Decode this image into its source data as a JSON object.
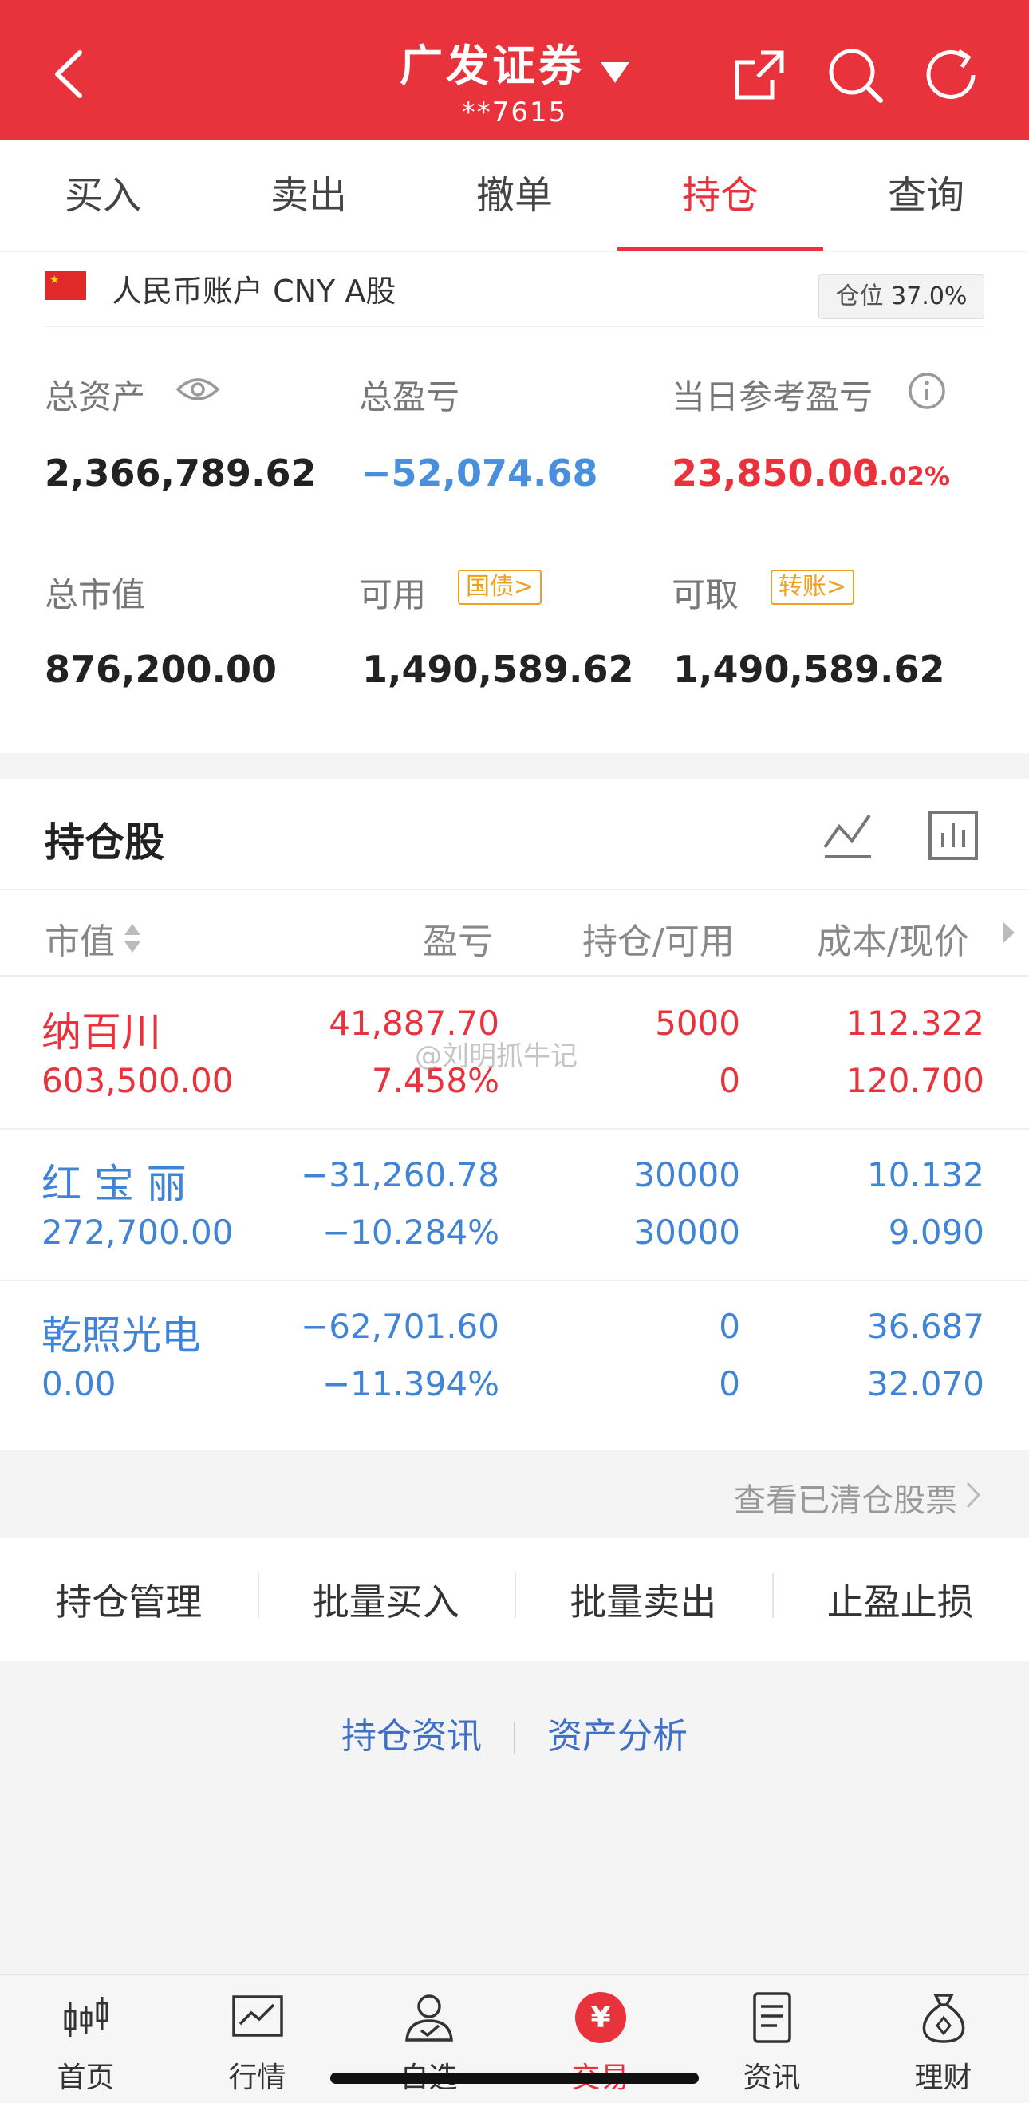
{
  "header": {
    "title": "广发证券",
    "account": "**7615",
    "colors": {
      "brand": "#e8333c"
    }
  },
  "tabs": [
    {
      "label": "买入"
    },
    {
      "label": "卖出"
    },
    {
      "label": "撤单"
    },
    {
      "label": "持仓",
      "active": true
    },
    {
      "label": "查询"
    }
  ],
  "account_info": {
    "currency_line": "人民币账户 CNY A股",
    "position_label": "仓位",
    "position_value": "37.0%"
  },
  "summary": {
    "total_assets_label": "总资产",
    "total_assets": "2,366,789.62",
    "total_pnl_label": "总盈亏",
    "total_pnl": "−52,074.68",
    "daily_pnl_label": "当日参考盈亏",
    "daily_pnl": "23,850.00",
    "daily_pnl_pct": "1.02%",
    "market_value_label": "总市值",
    "market_value": "876,200.00",
    "available_label": "可用",
    "available_tag": "国债>",
    "available": "1,490,589.62",
    "withdrawable_label": "可取",
    "withdrawable_tag": "转账>",
    "withdrawable": "1,490,589.62"
  },
  "holdings": {
    "title": "持仓股",
    "columns": [
      "市值",
      "盈亏",
      "持仓/可用",
      "成本/现价"
    ],
    "rows": [
      {
        "name": "纳百川",
        "market_value": "603,500.00",
        "pnl": "41,887.70",
        "pnl_pct": "7.458%",
        "position": "5000",
        "available": "0",
        "cost": "112.322",
        "price": "120.700",
        "tone": "red"
      },
      {
        "name": "红 宝 丽",
        "market_value": "272,700.00",
        "pnl": "−31,260.78",
        "pnl_pct": "−10.284%",
        "position": "30000",
        "available": "30000",
        "cost": "10.132",
        "price": "9.090",
        "tone": "blue"
      },
      {
        "name": "乾照光电",
        "market_value": "0.00",
        "pnl": "−62,701.60",
        "pnl_pct": "−11.394%",
        "position": "0",
        "available": "0",
        "cost": "36.687",
        "price": "32.070",
        "tone": "blue"
      }
    ]
  },
  "cleared_link": "查看已清仓股票",
  "actions": [
    "持仓管理",
    "批量买入",
    "批量卖出",
    "止盈止损"
  ],
  "links": [
    "持仓资讯",
    "资产分析"
  ],
  "watermark": "@刘明抓牛记",
  "bottom_nav": [
    {
      "label": "首页",
      "icon": "candlestick-icon"
    },
    {
      "label": "行情",
      "icon": "chart-icon"
    },
    {
      "label": "自选",
      "icon": "user-check-icon"
    },
    {
      "label": "交易",
      "icon": "yuan-icon",
      "active": true
    },
    {
      "label": "资讯",
      "icon": "document-icon"
    },
    {
      "label": "理财",
      "icon": "money-bag-icon"
    }
  ]
}
